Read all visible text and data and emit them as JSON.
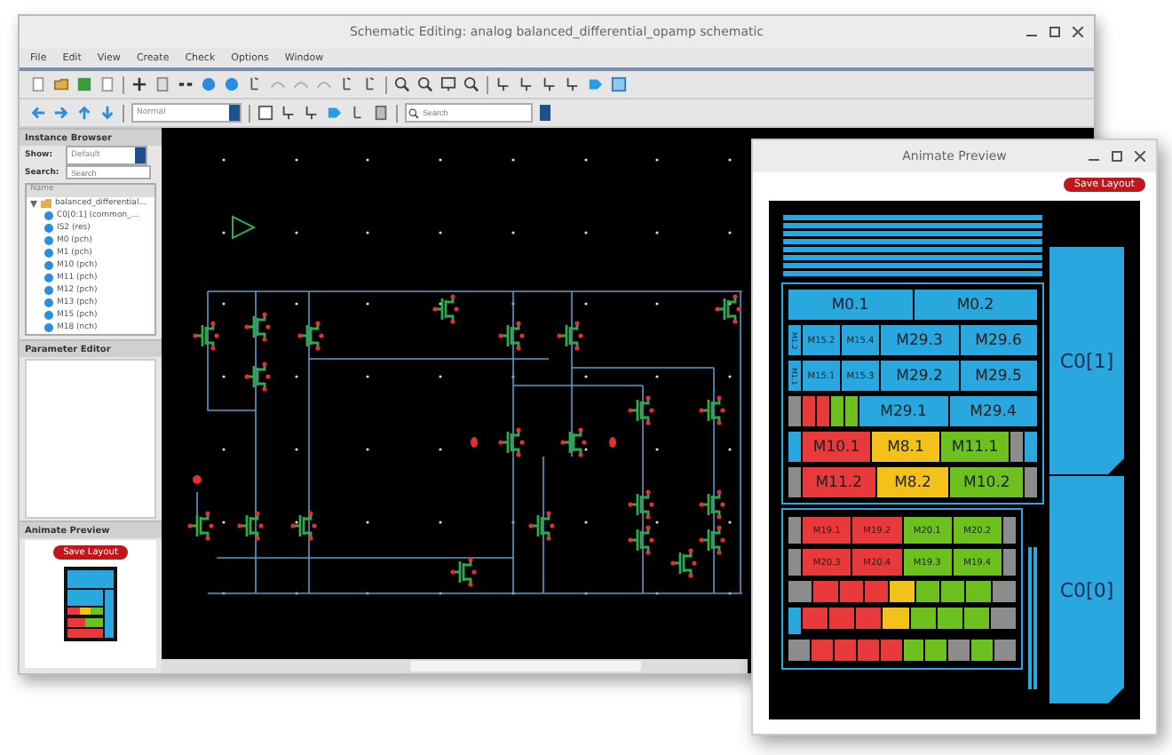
{
  "main_window": {
    "title": "Schematic Editing: analog balanced_differential_opamp schematic",
    "menu": [
      "File",
      "Edit",
      "View",
      "Create",
      "Check",
      "Options",
      "Window"
    ],
    "mode_field": {
      "value": "Normal"
    },
    "search": {
      "placeholder": "Search"
    }
  },
  "instance_browser": {
    "title": "Instance Browser",
    "show_label": "Show:",
    "show_value": "Default",
    "search_label": "Search:",
    "search_placeholder": "Search",
    "column": "Name",
    "tree": [
      {
        "label": "balanced_differential...",
        "expanded": true,
        "children": [
          {
            "label": "C0[0:1] (common_..."
          },
          {
            "label": "IS2 (res)"
          },
          {
            "label": "M0 (pch)"
          },
          {
            "label": "M1 (pch)"
          },
          {
            "label": "M10 (pch)"
          },
          {
            "label": "M11 (pch)"
          },
          {
            "label": "M12 (pch)"
          },
          {
            "label": "M13 (pch)"
          },
          {
            "label": "M15 (pch)"
          },
          {
            "label": "M18 (nch)"
          }
        ]
      }
    ]
  },
  "parameter_editor": {
    "title": "Parameter Editor"
  },
  "animate_panel": {
    "title": "Animate Preview",
    "button": "Save Layout"
  },
  "preview_window": {
    "title": "Animate Preview",
    "button": "Save Layout",
    "groups": [
      {
        "bands": [
          {
            "devices": [
              {
                "kind": "big",
                "label": "M0.1",
                "color": "#29a8e0"
              },
              {
                "kind": "big",
                "label": "M0.2",
                "color": "#29a8e0"
              }
            ]
          },
          {
            "devices": [
              {
                "kind": "stub",
                "label": "M1.2",
                "color": "#29a8e0"
              },
              {
                "kind": "small",
                "label": "M15.2",
                "color": "#29a8e0"
              },
              {
                "kind": "small",
                "label": "M15.4",
                "color": "#29a8e0"
              },
              {
                "kind": "big",
                "label": "M29.3",
                "color": "#29a8e0"
              },
              {
                "kind": "big",
                "label": "M29.6",
                "color": "#29a8e0"
              }
            ]
          },
          {
            "devices": [
              {
                "kind": "stub",
                "label": "M1.1",
                "color": "#29a8e0"
              },
              {
                "kind": "small",
                "label": "M15.1",
                "color": "#29a8e0"
              },
              {
                "kind": "small",
                "label": "M15.3",
                "color": "#29a8e0"
              },
              {
                "kind": "big",
                "label": "M29.2",
                "color": "#29a8e0"
              },
              {
                "kind": "big",
                "label": "M29.5",
                "color": "#29a8e0"
              }
            ]
          },
          {
            "devices": [
              {
                "kind": "stub",
                "color": "#8c8c8c"
              },
              {
                "kind": "stub",
                "color": "#e83a3a"
              },
              {
                "kind": "stub",
                "color": "#e83a3a"
              },
              {
                "kind": "stub",
                "color": "#6cc11f"
              },
              {
                "kind": "stub",
                "color": "#6cc11f"
              },
              {
                "kind": "big",
                "label": "M29.1",
                "color": "#29a8e0"
              },
              {
                "kind": "big",
                "label": "M29.4",
                "color": "#29a8e0"
              }
            ]
          },
          {
            "devices": [
              {
                "kind": "stub",
                "color": "#29a8e0"
              },
              {
                "kind": "big",
                "label": "M10.1",
                "color": "#e83a3a"
              },
              {
                "kind": "big",
                "label": "M8.1",
                "color": "#f2c21a"
              },
              {
                "kind": "big",
                "label": "M11.1",
                "color": "#6cc11f"
              },
              {
                "kind": "stub",
                "color": "#8c8c8c"
              },
              {
                "kind": "stub",
                "color": "#29a8e0"
              }
            ]
          },
          {
            "devices": [
              {
                "kind": "stub",
                "color": "#8c8c8c"
              },
              {
                "kind": "big",
                "label": "M11.2",
                "color": "#e83a3a"
              },
              {
                "kind": "big",
                "label": "M8.2",
                "color": "#f2c21a"
              },
              {
                "kind": "big",
                "label": "M10.2",
                "color": "#6cc11f"
              },
              {
                "kind": "stub",
                "color": "#8c8c8c"
              }
            ]
          }
        ]
      },
      {
        "bands": [
          {
            "devices": [
              {
                "kind": "stub",
                "color": "#8c8c8c"
              },
              {
                "kind": "mid",
                "label": "M19.1",
                "color": "#e83a3a"
              },
              {
                "kind": "mid",
                "label": "M19.2",
                "color": "#e83a3a"
              },
              {
                "kind": "mid",
                "label": "M20.1",
                "color": "#6cc11f"
              },
              {
                "kind": "mid",
                "label": "M20.2",
                "color": "#6cc11f"
              },
              {
                "kind": "stub",
                "color": "#8c8c8c"
              }
            ]
          },
          {
            "devices": [
              {
                "kind": "stub",
                "color": "#8c8c8c"
              },
              {
                "kind": "mid",
                "label": "M20.3",
                "color": "#e83a3a"
              },
              {
                "kind": "mid",
                "label": "M20.4",
                "color": "#e83a3a"
              },
              {
                "kind": "mid",
                "label": "M19.3",
                "color": "#6cc11f"
              },
              {
                "kind": "mid",
                "label": "M19.4",
                "color": "#6cc11f"
              },
              {
                "kind": "stub",
                "color": "#8c8c8c"
              }
            ]
          },
          {
            "devices": [
              {
                "kind": "blank",
                "color": "#8c8c8c"
              },
              {
                "kind": "blank",
                "color": "#e83a3a"
              },
              {
                "kind": "blank",
                "color": "#e83a3a"
              },
              {
                "kind": "blank",
                "color": "#e83a3a"
              },
              {
                "kind": "blank",
                "color": "#f2c21a"
              },
              {
                "kind": "blank",
                "color": "#6cc11f"
              },
              {
                "kind": "blank",
                "color": "#6cc11f"
              },
              {
                "kind": "blank",
                "color": "#6cc11f"
              },
              {
                "kind": "blank",
                "color": "#8c8c8c"
              }
            ]
          },
          {
            "devices": [
              {
                "kind": "stub",
                "color": "#29a8e0"
              },
              {
                "kind": "blank",
                "color": "#e83a3a"
              },
              {
                "kind": "blank",
                "color": "#e83a3a"
              },
              {
                "kind": "blank",
                "color": "#e83a3a"
              },
              {
                "kind": "blank",
                "color": "#f2c21a"
              },
              {
                "kind": "blank",
                "color": "#6cc11f"
              },
              {
                "kind": "blank",
                "color": "#6cc11f"
              },
              {
                "kind": "blank",
                "color": "#6cc11f"
              },
              {
                "kind": "blank",
                "color": "#8c8c8c"
              }
            ]
          },
          {
            "devices": [
              {
                "kind": "blank",
                "color": "#8c8c8c"
              },
              {
                "kind": "blank",
                "color": "#e83a3a"
              },
              {
                "kind": "blank",
                "color": "#e83a3a"
              },
              {
                "kind": "blank",
                "color": "#e83a3a"
              },
              {
                "kind": "blank",
                "color": "#e83a3a"
              },
              {
                "kind": "blank",
                "color": "#6cc11f"
              },
              {
                "kind": "blank",
                "color": "#6cc11f"
              },
              {
                "kind": "blank",
                "color": "#8c8c8c"
              },
              {
                "kind": "blank",
                "color": "#6cc11f"
              },
              {
                "kind": "blank",
                "color": "#8c8c8c"
              }
            ]
          }
        ]
      }
    ],
    "capacitors": [
      {
        "label": "C0[1]"
      },
      {
        "label": "C0[0]"
      }
    ]
  }
}
